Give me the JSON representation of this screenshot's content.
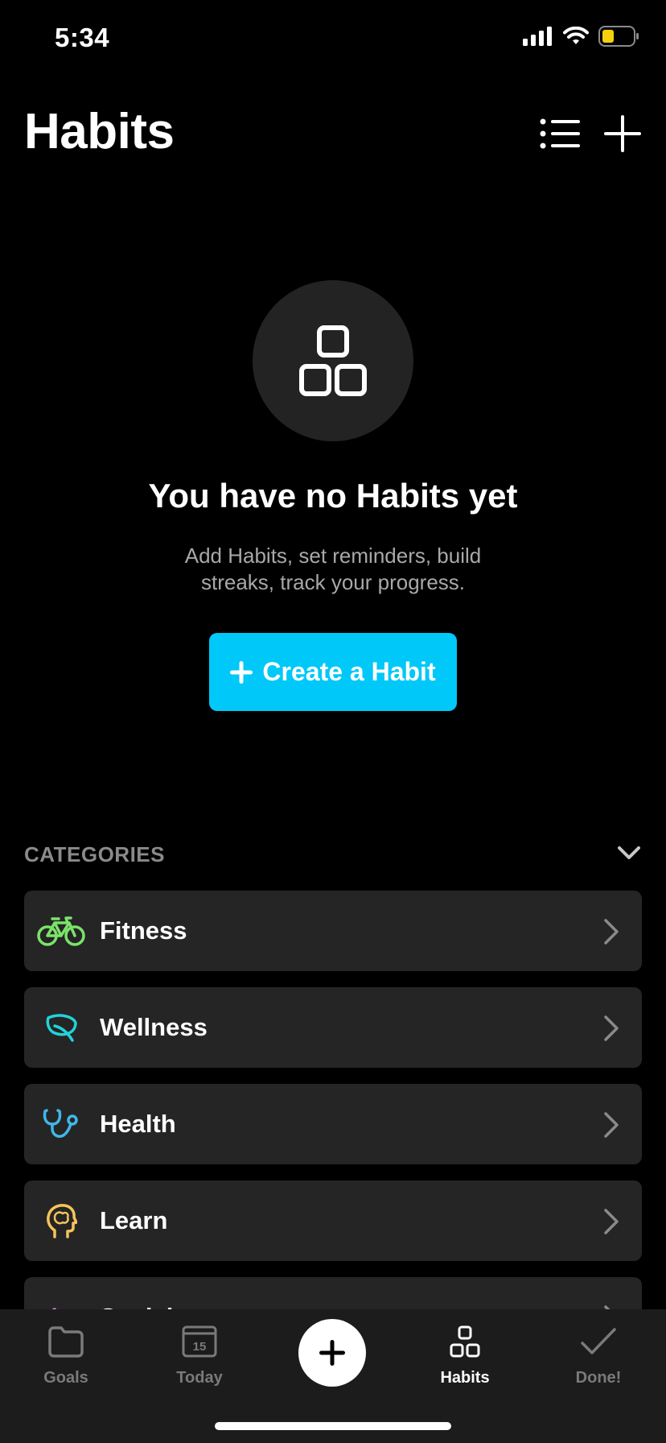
{
  "status": {
    "time": "5:34",
    "battery_color": "#f5d10d"
  },
  "header": {
    "title": "Habits",
    "list_icon": "list-icon",
    "add_icon": "plus-icon"
  },
  "empty_state": {
    "icon": "habits-blocks-icon",
    "title": "You have no Habits yet",
    "description": "Add Habits, set reminders, build streaks, track your progress.",
    "button_label": "Create a Habit",
    "button_color": "#00c8f8"
  },
  "categories": {
    "title": "CATEGORIES",
    "items": [
      {
        "label": "Fitness",
        "icon": "bicycle-icon",
        "color": "#7be36a"
      },
      {
        "label": "Wellness",
        "icon": "leaf-icon",
        "color": "#22d3d8"
      },
      {
        "label": "Health",
        "icon": "stethoscope-icon",
        "color": "#3fb8e8"
      },
      {
        "label": "Learn",
        "icon": "brain-head-icon",
        "color": "#f5c45a"
      },
      {
        "label": "Social",
        "icon": "moon-icon",
        "color": "#e08ae8"
      }
    ]
  },
  "tabbar": {
    "tabs": [
      {
        "label": "Goals",
        "icon": "folder-icon"
      },
      {
        "label": "Today",
        "icon": "calendar-icon",
        "badge": "15"
      },
      {
        "label": "Habits",
        "icon": "habits-blocks-icon",
        "active": true
      },
      {
        "label": "Done!",
        "icon": "checkmark-icon"
      }
    ]
  }
}
